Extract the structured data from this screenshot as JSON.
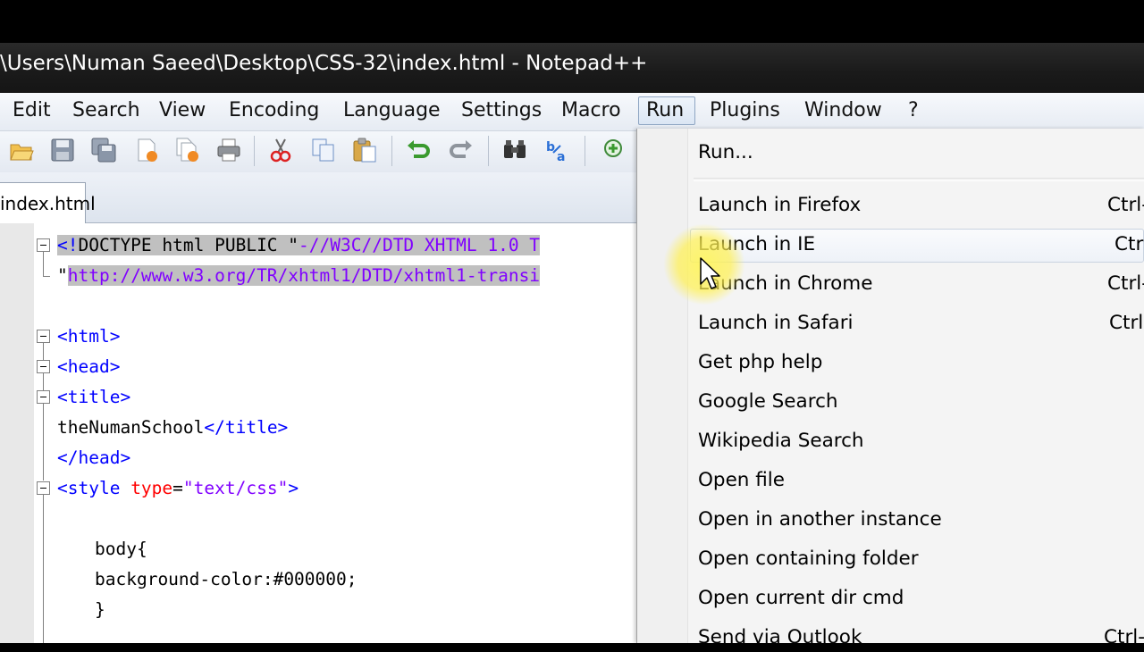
{
  "window": {
    "title": "\\Users\\Numan Saeed\\Desktop\\CSS-32\\index.html - Notepad++"
  },
  "menubar": {
    "items": [
      {
        "label": "Edit"
      },
      {
        "label": "Search"
      },
      {
        "label": "View"
      },
      {
        "label": "Encoding"
      },
      {
        "label": "Language"
      },
      {
        "label": "Settings"
      },
      {
        "label": "Macro"
      },
      {
        "label": "Run",
        "active": true
      },
      {
        "label": "Plugins"
      },
      {
        "label": "Window"
      },
      {
        "label": "?"
      }
    ]
  },
  "toolbar": {
    "icons": [
      "open-icon",
      "save-icon",
      "save-all-icon",
      "close-icon",
      "close-all-icon",
      "print-icon",
      "cut-icon",
      "copy-icon",
      "paste-icon",
      "undo-icon",
      "redo-icon",
      "find-icon",
      "replace-icon",
      "zoom-in-icon"
    ]
  },
  "tabs": [
    {
      "label": "index.html"
    }
  ],
  "editor": {
    "lines": {
      "l1a": "<!",
      "l1b": "DOCTYPE html PUBLIC \"",
      "l1c": "-//W3C//DTD XHTML 1.0 T",
      "l2a": "\"",
      "l2b": "http://www.w3.org/TR/xhtml1/DTD/xhtml1-transi",
      "l3": "<html>",
      "l4": "<head>",
      "l5": "<title>",
      "l6a": "theNumanSchool",
      "l6b": "</title>",
      "l7": "</head>",
      "l8a": "<style ",
      "l8b": "type",
      "l8c": "=",
      "l8d": "\"text/css\"",
      "l8e": ">",
      "l9": "body{",
      "l10": "background-color:#000000;",
      "l11": "}"
    }
  },
  "run_menu": {
    "run": "Run...",
    "items": [
      {
        "label": "Launch in Firefox",
        "shortcut": "Ctrl-"
      },
      {
        "label": "Launch in IE",
        "shortcut": "Ctr"
      },
      {
        "label": "Launch in Chrome",
        "shortcut": "Ctrl-"
      },
      {
        "label": "Launch in Safari",
        "shortcut": "Ctrl"
      },
      {
        "label": "Get php help",
        "shortcut": ""
      },
      {
        "label": "Google Search",
        "shortcut": ""
      },
      {
        "label": "Wikipedia Search",
        "shortcut": ""
      },
      {
        "label": "Open file",
        "shortcut": ""
      },
      {
        "label": "Open in another instance",
        "shortcut": ""
      },
      {
        "label": "Open containing folder",
        "shortcut": ""
      },
      {
        "label": "Open current dir cmd",
        "shortcut": ""
      },
      {
        "label": "Send via Outlook",
        "shortcut": "Ctrl-"
      }
    ]
  }
}
